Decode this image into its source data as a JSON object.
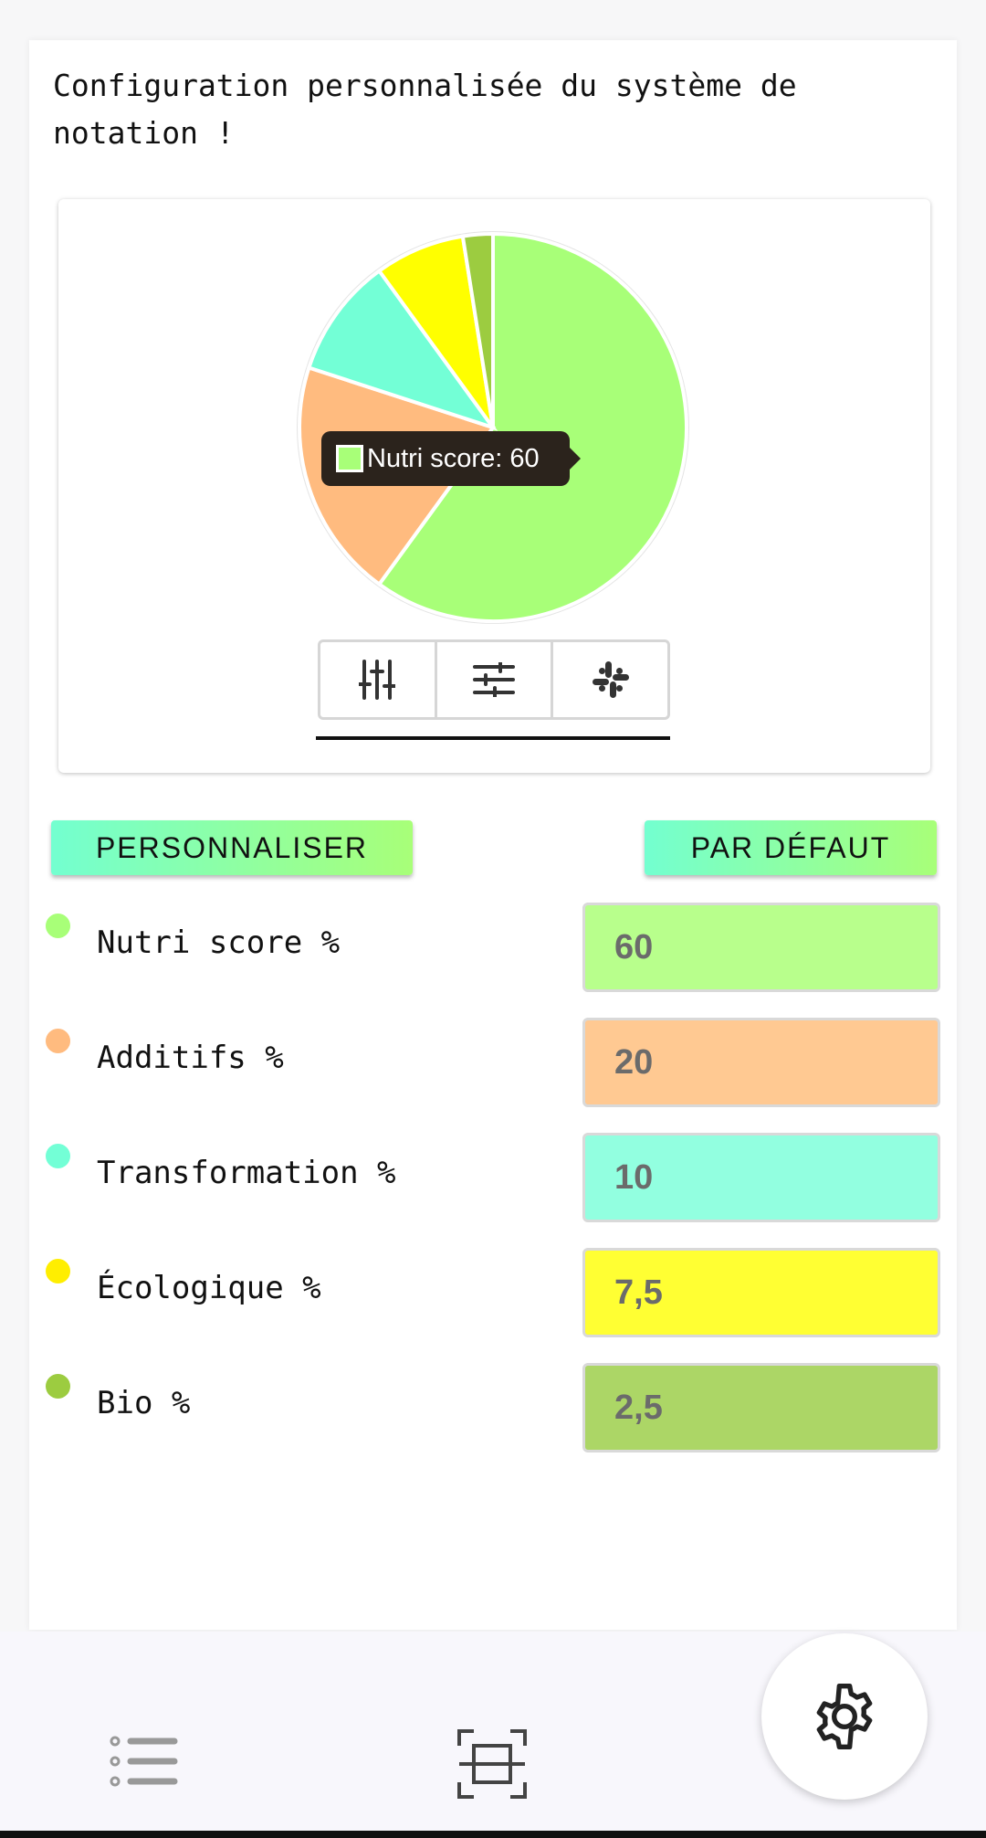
{
  "page": {
    "headline": "Configuration personnalisée du système de notation !"
  },
  "chart_data": {
    "type": "pie",
    "categories": [
      "Nutri score",
      "Additifs",
      "Transformation",
      "Écologique",
      "Bio"
    ],
    "values": [
      60,
      20,
      10,
      7.5,
      2.5
    ],
    "colors": [
      "#a8ff78",
      "#ffbb7f",
      "#73ffd6",
      "#ffff00",
      "#9ccc40"
    ],
    "start_angle_deg": 0,
    "direction": "clockwise"
  },
  "tooltip": {
    "text": "Nutri score: 60",
    "color": "#a8ff78"
  },
  "chart_toolbar": {
    "buttons": [
      {
        "icon": "vertical-sliders-icon"
      },
      {
        "icon": "horizontal-sliders-icon"
      },
      {
        "icon": "slack-icon"
      }
    ]
  },
  "actions": {
    "custom_label": "PERSONNALISER",
    "default_label": "PAR DÉFAUT"
  },
  "criteria": [
    {
      "label": "Nutri score %",
      "value": "60",
      "dot_color": "#a8ff78",
      "field_color": "#b8ff8c"
    },
    {
      "label": "Additifs %",
      "value": "20",
      "dot_color": "#ffbb7f",
      "field_color": "#ffc992"
    },
    {
      "label": "Transformation %",
      "value": "10",
      "dot_color": "#73ffd6",
      "field_color": "#92ffe0"
    },
    {
      "label": "Écologique %",
      "value": "7,5",
      "dot_color": "#ffee00",
      "field_color": "#ffff33"
    },
    {
      "label": "Bio %",
      "value": "2,5",
      "dot_color": "#9ccc40",
      "field_color": "#acd666"
    }
  ],
  "bottom_nav": {
    "items": [
      {
        "icon": "list-icon"
      },
      {
        "icon": "scan-icon"
      },
      {
        "icon": "gear-icon"
      }
    ]
  }
}
